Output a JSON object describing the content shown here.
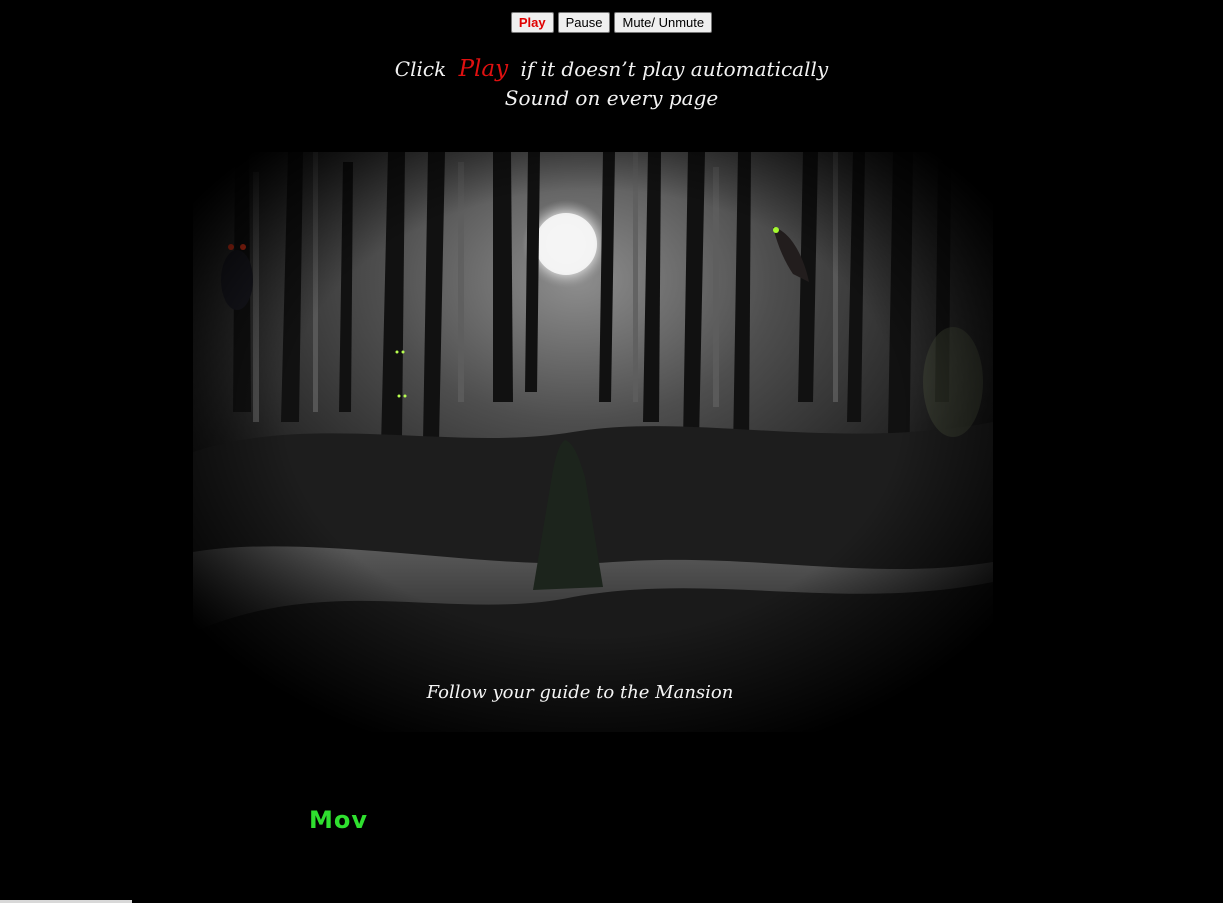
{
  "controls": {
    "play_label": "Play",
    "pause_label": "Pause",
    "mute_label": "Mute/ Unmute"
  },
  "intro": {
    "click_word": "Click",
    "play_word": "Play",
    "rest": "if it doesn’t play automatically",
    "line2": "Sound on every page"
  },
  "scene": {
    "caption": "Follow your guide to the Mansion"
  },
  "marquee": {
    "text": "Mov"
  },
  "colors": {
    "background": "#000000",
    "accent_red": "#e01010",
    "marquee_green": "#2fe02f",
    "text": "#f2f2f2"
  }
}
